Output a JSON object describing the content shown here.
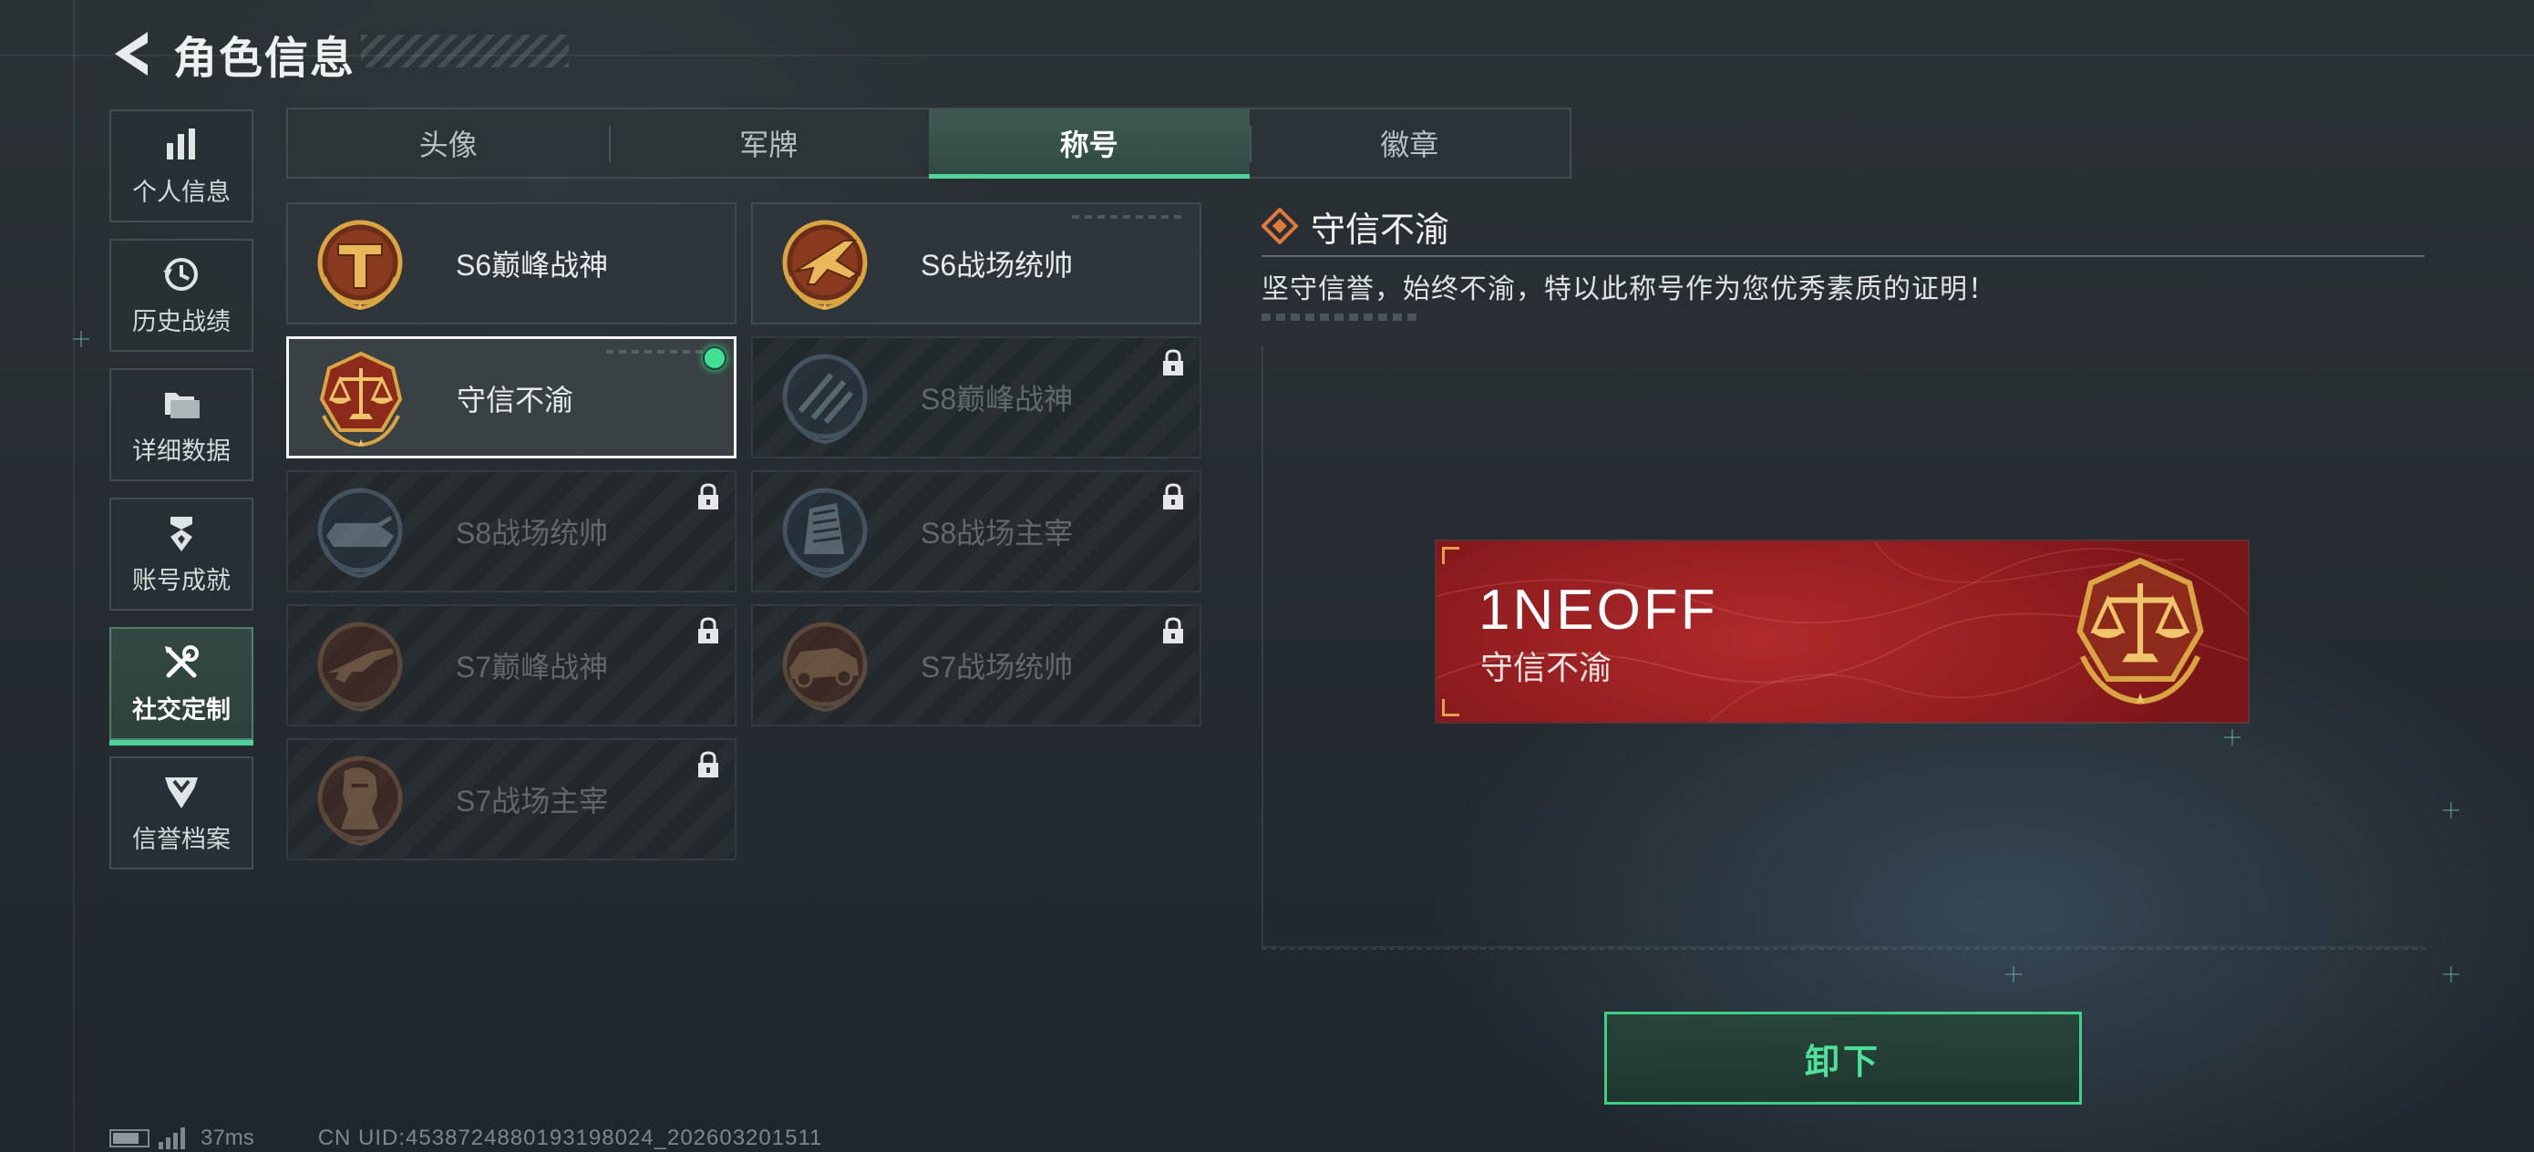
{
  "header": {
    "title": "角色信息",
    "back_icon": "back-arrow-icon"
  },
  "sidenav": {
    "items": [
      {
        "label": "个人信息",
        "icon": "bar-chart-icon",
        "active": false
      },
      {
        "label": "历史战绩",
        "icon": "history-icon",
        "active": false
      },
      {
        "label": "详细数据",
        "icon": "folder-icon",
        "active": false
      },
      {
        "label": "账号成就",
        "icon": "medal-icon",
        "active": false
      },
      {
        "label": "社交定制",
        "icon": "wrench-screwdriver-icon",
        "active": true
      },
      {
        "label": "信誉档案",
        "icon": "shield-chevron-icon",
        "active": false
      }
    ]
  },
  "tabs": [
    {
      "label": "头像",
      "active": false
    },
    {
      "label": "军牌",
      "active": false
    },
    {
      "label": "称号",
      "active": true
    },
    {
      "label": "徽章",
      "active": false
    }
  ],
  "titles": [
    {
      "name": "S6巅峰战神",
      "badge": "s6-peak-god-badge-icon",
      "locked": false,
      "selected": false,
      "equipped": false
    },
    {
      "name": "S6战场统帅",
      "badge": "s6-commander-jet-badge-icon",
      "locked": false,
      "selected": false,
      "equipped": false
    },
    {
      "name": "守信不渝",
      "badge": "scales-badge-icon",
      "locked": false,
      "selected": true,
      "equipped": true
    },
    {
      "name": "S8巅峰战神",
      "badge": "s8-peak-god-badge-icon",
      "locked": true,
      "selected": false,
      "equipped": false
    },
    {
      "name": "S8战场统帅",
      "badge": "s8-commander-tank-badge-icon",
      "locked": true,
      "selected": false,
      "equipped": false
    },
    {
      "name": "S8战场主宰",
      "badge": "s8-dominator-building-badge-icon",
      "locked": true,
      "selected": false,
      "equipped": false
    },
    {
      "name": "S7巅峰战神",
      "badge": "s7-peak-god-rifle-badge-icon",
      "locked": true,
      "selected": false,
      "equipped": false
    },
    {
      "name": "S7战场统帅",
      "badge": "s7-commander-vehicle-badge-icon",
      "locked": true,
      "selected": false,
      "equipped": false
    },
    {
      "name": "S7战场主宰",
      "badge": "s7-dominator-soldier-badge-icon",
      "locked": true,
      "selected": false,
      "equipped": false
    }
  ],
  "detail": {
    "title": "守信不渝",
    "description": "坚守信誉，始终不渝，特以此称号作为您优秀素质的证明！"
  },
  "nameplate": {
    "player_name": "1NEOFF",
    "title": "守信不渝",
    "badge": "scales-badge-icon"
  },
  "actions": {
    "unequip_label": "卸下"
  },
  "footer": {
    "ping": "37ms",
    "uid": "CN UID:4538724880193198024_202603201511"
  },
  "colors": {
    "accent_green": "#4fd39a",
    "nameplate_red": "#a9252a",
    "badge_gold": "#d9a441"
  }
}
